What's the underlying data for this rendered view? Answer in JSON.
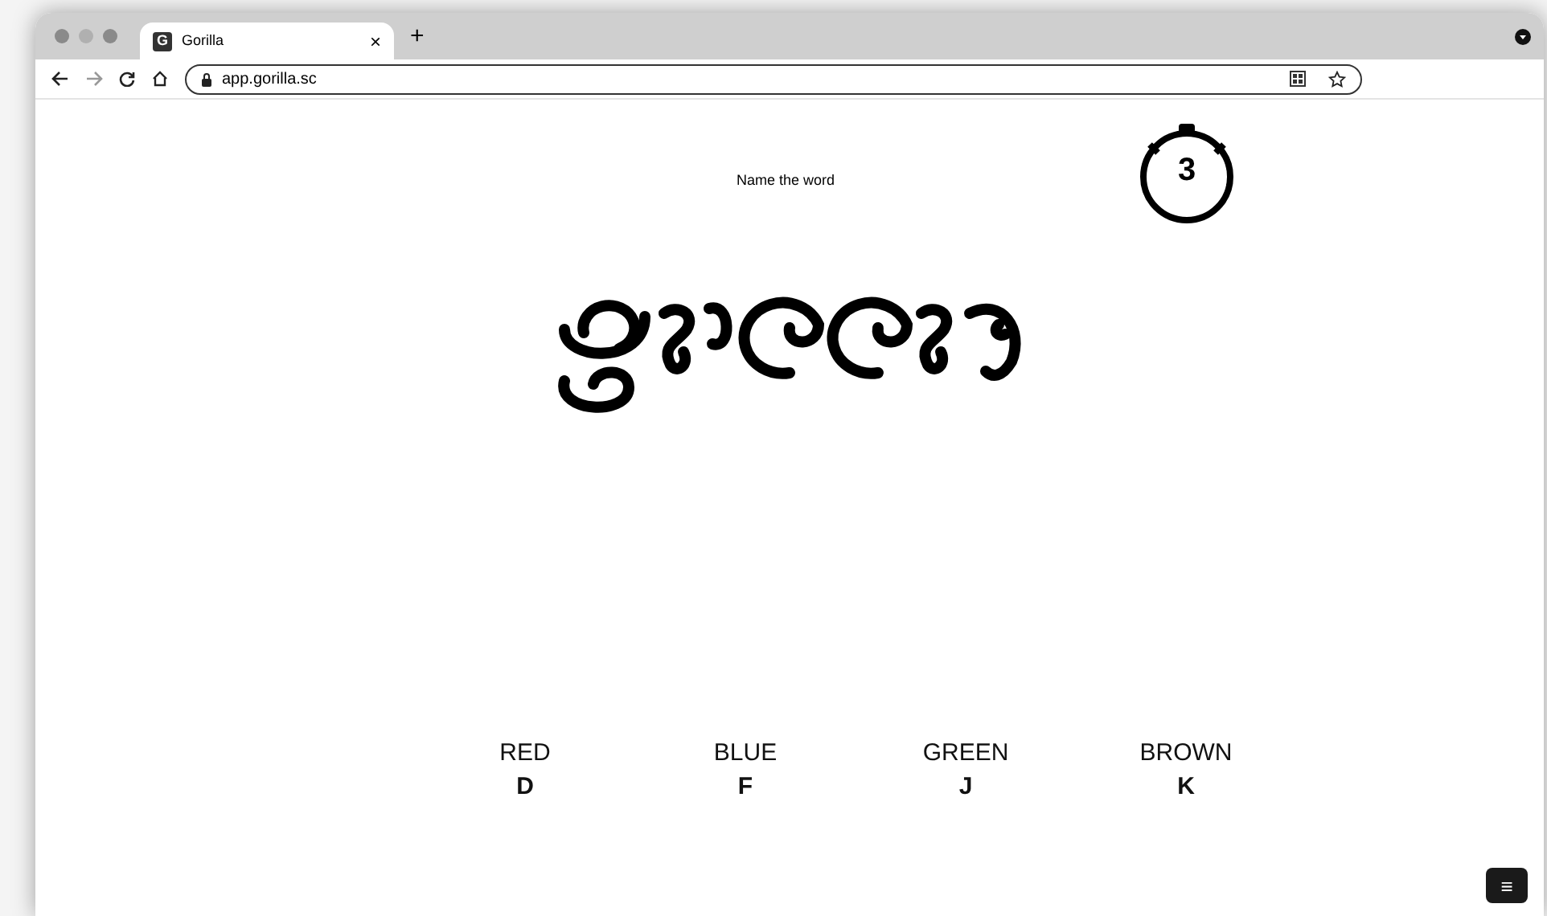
{
  "browser": {
    "tab_title": "Gorilla",
    "tab_icon": "G",
    "new_tab": "+",
    "close": "×",
    "url": "app.gorilla.sc"
  },
  "task": {
    "prompt": "Name the word",
    "timer": "3"
  },
  "options": [
    {
      "label": "RED",
      "key": "D"
    },
    {
      "label": "BLUE",
      "key": "F"
    },
    {
      "label": "GREEN",
      "key": "J"
    },
    {
      "label": "BROWN",
      "key": "K"
    }
  ],
  "menu_button": "≡"
}
